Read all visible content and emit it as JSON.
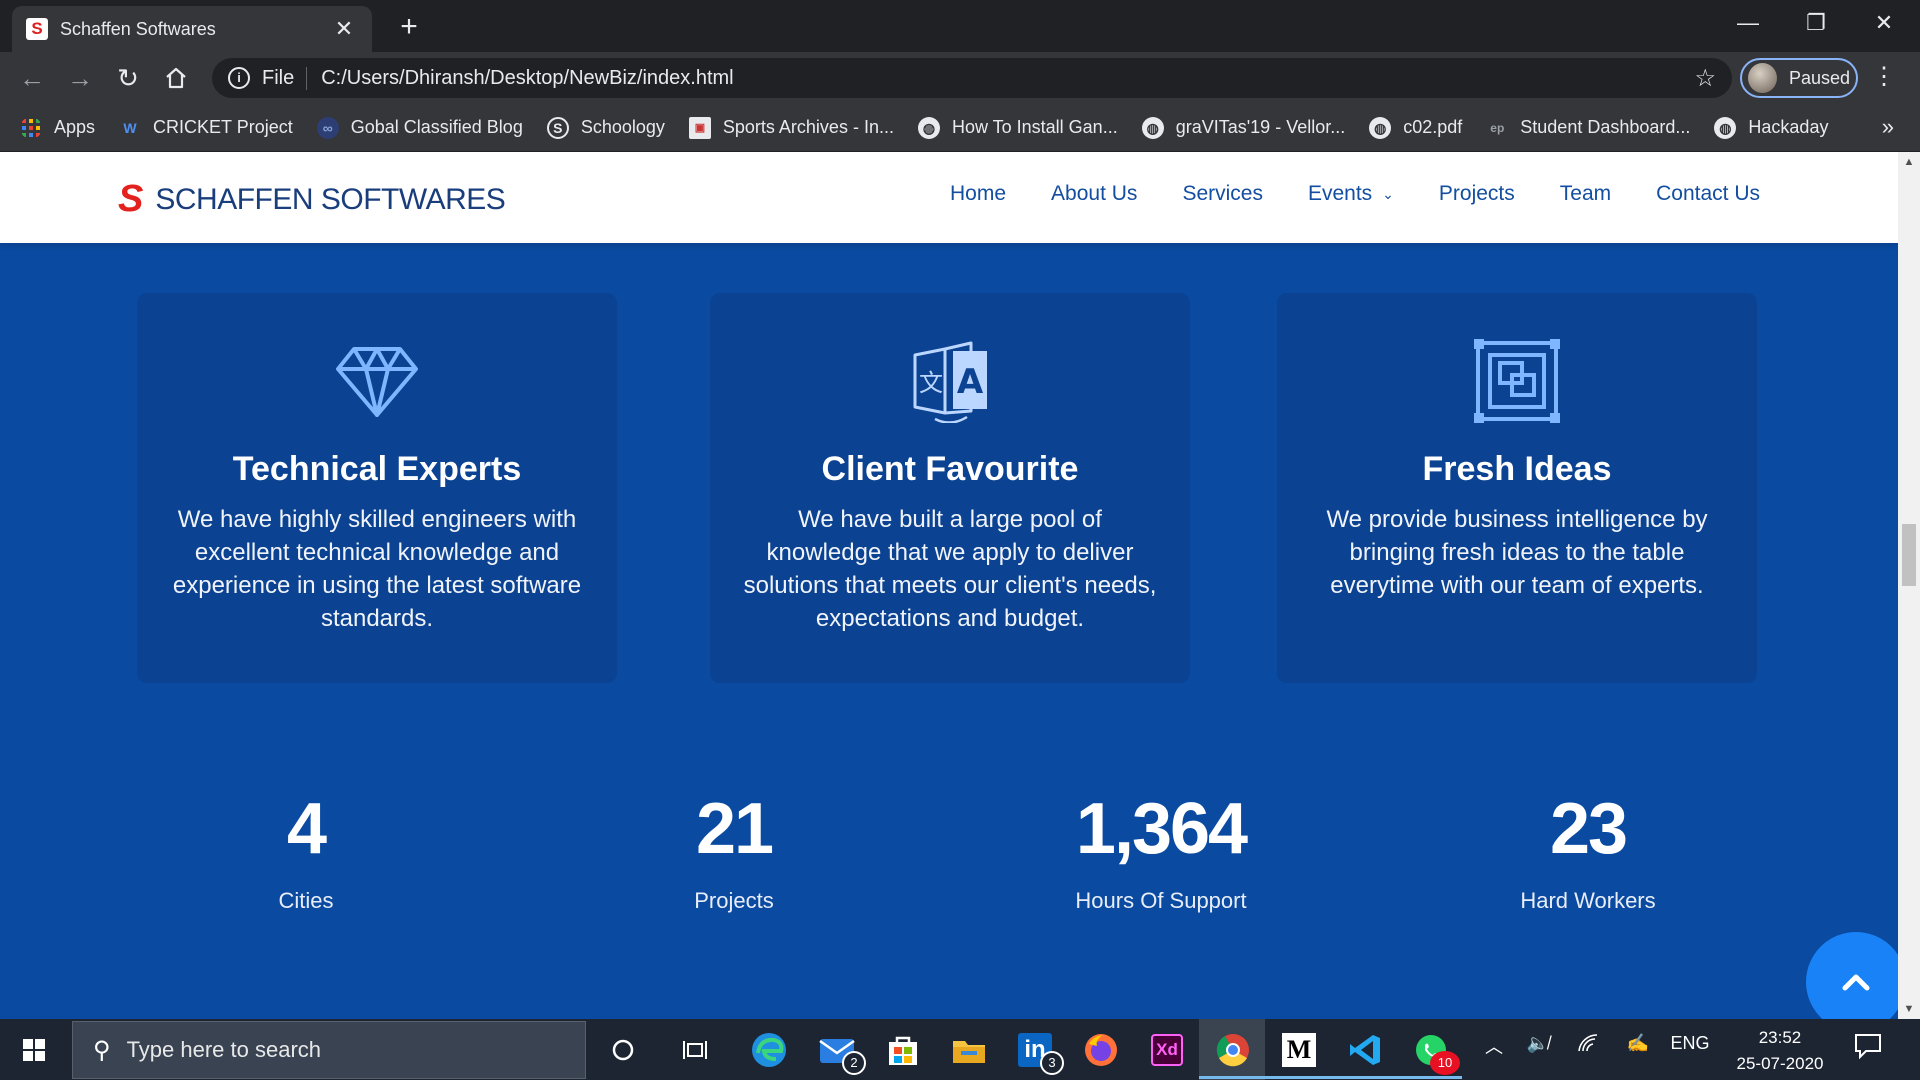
{
  "browser": {
    "tab": {
      "title": "Schaffen Softwares",
      "favicon": "S"
    },
    "new_tab": "+",
    "window_controls": {
      "minimize": "—",
      "restore": "❐",
      "close": "✕"
    },
    "omnibox": {
      "scheme_label": "File",
      "url": "C:/Users/Dhiransh/Desktop/NewBiz/index.html"
    },
    "profile": {
      "label": "Paused"
    },
    "bookmarks": [
      {
        "label": "Apps",
        "icon": "apps-grid-icon"
      },
      {
        "label": "CRICKET Project",
        "icon": "w-logo-icon"
      },
      {
        "label": "Gobal Classified Blog",
        "icon": "blog-icon"
      },
      {
        "label": "Schoology",
        "icon": "schoology-icon"
      },
      {
        "label": "Sports Archives - In...",
        "icon": "sports-icon"
      },
      {
        "label": "How To Install Gan...",
        "icon": "globe-icon"
      },
      {
        "label": "graVITas'19 - Vellor...",
        "icon": "globe-icon"
      },
      {
        "label": "c02.pdf",
        "icon": "globe-icon"
      },
      {
        "label": "Student Dashboard...",
        "icon": "dashboard-icon"
      },
      {
        "label": "Hackaday",
        "icon": "globe-icon"
      }
    ],
    "bookmarks_more": "»"
  },
  "site": {
    "logo_mark": "S",
    "logo_text": "SCHAFFEN SOFTWARES",
    "nav": [
      "Home",
      "About Us",
      "Services",
      "Events",
      "Projects",
      "Team",
      "Contact Us"
    ],
    "features": [
      {
        "icon": "diamond-icon",
        "title": "Technical Experts",
        "desc": "We have highly skilled engineers with excellent technical knowledge and experience in using the latest software standards."
      },
      {
        "icon": "translate-icon",
        "title": "Client Favourite",
        "desc": "We have built a large pool of knowledge that we apply to deliver solutions that meets our client's needs, expectations and budget."
      },
      {
        "icon": "frame-icon",
        "title": "Fresh Ideas",
        "desc": "We provide business intelligence by bringing fresh ideas to the table everytime with our team of experts."
      }
    ],
    "stats": [
      {
        "value": "4",
        "label": "Cities"
      },
      {
        "value": "21",
        "label": "Projects"
      },
      {
        "value": "1,364",
        "label": "Hours Of Support"
      },
      {
        "value": "23",
        "label": "Hard Workers"
      }
    ],
    "colors": {
      "background": "#0a4aa0",
      "card": "#0b4291",
      "nav_text": "#134ea0",
      "logo_red": "#e3211d",
      "back_to_top": "#1a82f7"
    }
  },
  "taskbar": {
    "search_placeholder": "Type here to search",
    "apps": [
      {
        "name": "cortana",
        "label": ""
      },
      {
        "name": "task-view",
        "label": ""
      },
      {
        "name": "edge",
        "label": ""
      },
      {
        "name": "mail",
        "label": "",
        "badge": "2"
      },
      {
        "name": "store",
        "label": ""
      },
      {
        "name": "file-explorer",
        "label": ""
      },
      {
        "name": "linkedin",
        "label": "in",
        "badge": "3"
      },
      {
        "name": "firefox",
        "label": ""
      },
      {
        "name": "adobe-xd",
        "label": "Xd"
      },
      {
        "name": "chrome",
        "label": ""
      },
      {
        "name": "medium",
        "label": "M"
      },
      {
        "name": "vscode",
        "label": ""
      },
      {
        "name": "whatsapp",
        "label": "",
        "badge": "10"
      }
    ],
    "tray": {
      "language": "ENG"
    },
    "clock": {
      "time": "23:52",
      "date": "25-07-2020"
    }
  }
}
